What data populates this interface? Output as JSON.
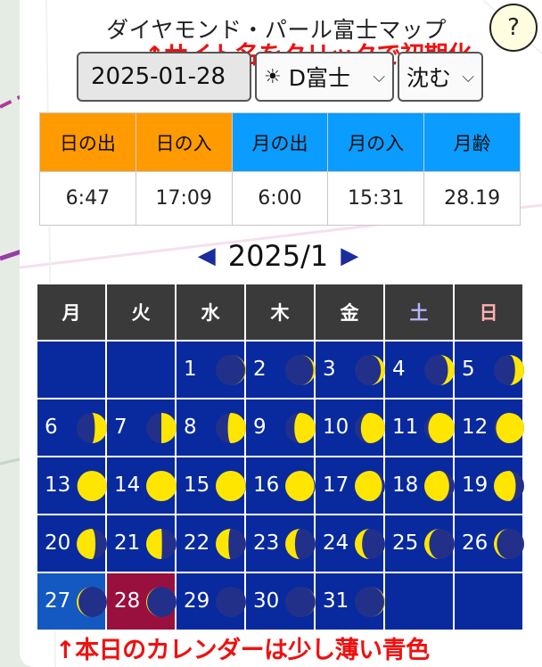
{
  "header": {
    "title": "ダイヤモンド・パール富士マップ",
    "help_label": "?"
  },
  "annotations": {
    "top_note": "↑サイト名をクリックで初期化",
    "bottom_note": "↑本日のカレンダーは少し薄い青色",
    "note_color": "#ee1111"
  },
  "controls": {
    "date_value": "2025-01-28",
    "type_icon": "sun-icon",
    "type_value": "D富士",
    "mode_value": "沈む"
  },
  "sun_moon_table": {
    "headers": [
      "日の出",
      "日の入",
      "月の出",
      "月の入",
      "月齢"
    ],
    "values": [
      "6:47",
      "17:09",
      "6:00",
      "15:31",
      "28.19"
    ],
    "colors": {
      "sun": "#ff9a00",
      "moon": "#0a9cff"
    }
  },
  "calendar": {
    "month_label": "2025/1",
    "prev_icon": "triangle-left-icon",
    "next_icon": "triangle-right-icon",
    "weekday_headers": [
      "月",
      "火",
      "水",
      "木",
      "金",
      "土",
      "日"
    ],
    "weekday_colors": [
      "#ffffff",
      "#ffffff",
      "#ffffff",
      "#ffffff",
      "#ffffff",
      "#b9b3ff",
      "#ffb0b0"
    ],
    "weeks": [
      [
        {
          "day": ""
        },
        {
          "day": ""
        },
        {
          "day": "1",
          "illum": 0.03,
          "waxing": true
        },
        {
          "day": "2",
          "illum": 0.07,
          "waxing": true
        },
        {
          "day": "3",
          "illum": 0.14,
          "waxing": true
        },
        {
          "day": "4",
          "illum": 0.22,
          "waxing": true
        },
        {
          "day": "5",
          "illum": 0.3,
          "waxing": true
        }
      ],
      [
        {
          "day": "6",
          "illum": 0.4,
          "waxing": true
        },
        {
          "day": "7",
          "illum": 0.5,
          "waxing": true
        },
        {
          "day": "8",
          "illum": 0.6,
          "waxing": true
        },
        {
          "day": "9",
          "illum": 0.7,
          "waxing": true
        },
        {
          "day": "10",
          "illum": 0.8,
          "waxing": true
        },
        {
          "day": "11",
          "illum": 0.87,
          "waxing": true
        },
        {
          "day": "12",
          "illum": 0.93,
          "waxing": true
        }
      ],
      [
        {
          "day": "13",
          "illum": 0.98,
          "waxing": true
        },
        {
          "day": "14",
          "illum": 1.0,
          "waxing": true
        },
        {
          "day": "15",
          "illum": 0.99,
          "waxing": false
        },
        {
          "day": "16",
          "illum": 0.96,
          "waxing": false
        },
        {
          "day": "17",
          "illum": 0.9,
          "waxing": false
        },
        {
          "day": "18",
          "illum": 0.82,
          "waxing": false
        },
        {
          "day": "19",
          "illum": 0.72,
          "waxing": false
        }
      ],
      [
        {
          "day": "20",
          "illum": 0.62,
          "waxing": false
        },
        {
          "day": "21",
          "illum": 0.52,
          "waxing": false
        },
        {
          "day": "22",
          "illum": 0.42,
          "waxing": false
        },
        {
          "day": "23",
          "illum": 0.32,
          "waxing": false
        },
        {
          "day": "24",
          "illum": 0.24,
          "waxing": false
        },
        {
          "day": "25",
          "illum": 0.16,
          "waxing": false
        },
        {
          "day": "26",
          "illum": 0.1,
          "waxing": false
        }
      ],
      [
        {
          "day": "27",
          "illum": 0.06,
          "waxing": false,
          "state": "today"
        },
        {
          "day": "28",
          "illum": 0.03,
          "waxing": false,
          "state": "selected"
        },
        {
          "day": "29",
          "illum": 0.0,
          "waxing": true
        },
        {
          "day": "30",
          "illum": 0.01,
          "waxing": true
        },
        {
          "day": "31",
          "illum": 0.03,
          "waxing": true
        },
        {
          "day": ""
        },
        {
          "day": ""
        }
      ]
    ],
    "colors": {
      "cell": "#082a9e",
      "today": "#1458c2",
      "selected": "#99103f",
      "header": "#3a3a3a",
      "moon_lit": "#ffe600",
      "moon_dark": "#23308a"
    }
  }
}
